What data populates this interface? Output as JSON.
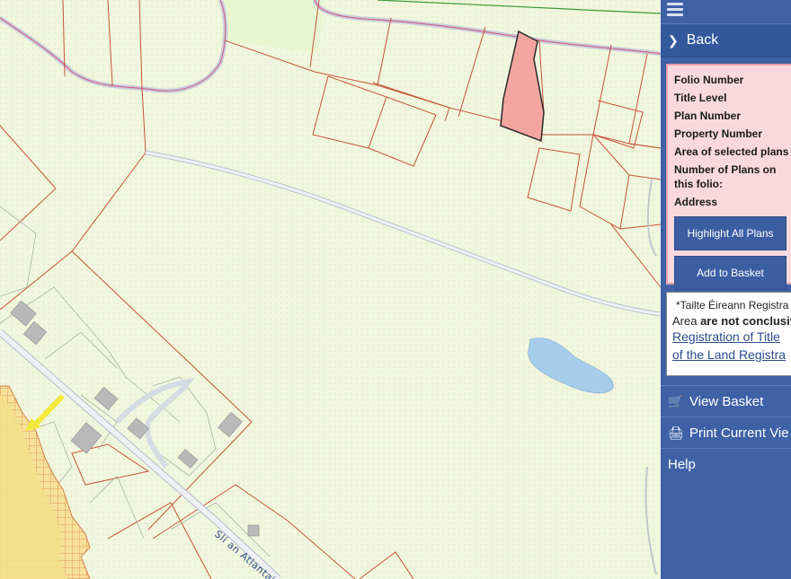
{
  "map": {
    "road_label": "Slí an Atlantaig"
  },
  "panel": {
    "back_label": "Back",
    "info_fields": [
      "Folio Number",
      "Title Level",
      "Plan Number",
      "Property Number",
      "Area of selected plans",
      "Number of Plans on this folio:",
      "Address"
    ],
    "highlight_button": "Highlight All Plans",
    "basket_button": "Add to Basket",
    "disclaimer": {
      "line1": "*Tailte Éireann Registra",
      "line2_prefix": "Area ",
      "line2_bold": "are not conclusiv",
      "link1": "Registration of Title",
      "link2": "of the Land Registra"
    },
    "nav": {
      "view_basket": "View Basket",
      "print_view": "Print Current Vie",
      "help": "Help"
    }
  },
  "colors": {
    "panel_bg": "#3f62a6",
    "card_bg": "#f9d9dd",
    "selected_plot": "#f4a5a0",
    "map_bg": "#f1f6de"
  }
}
